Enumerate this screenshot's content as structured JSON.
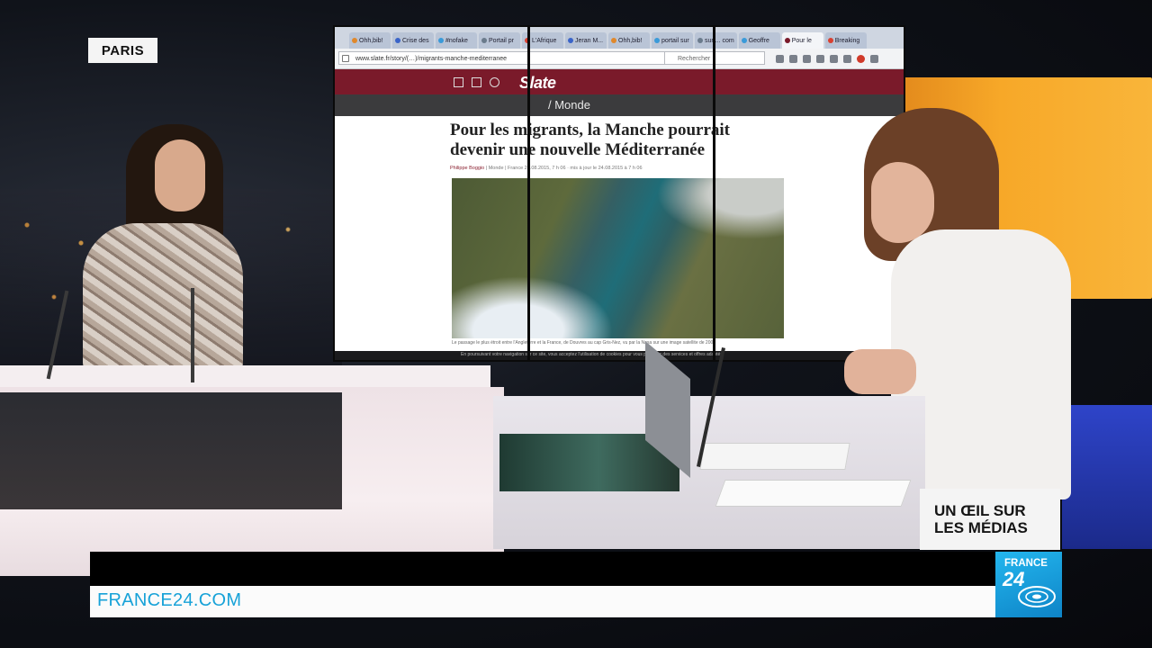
{
  "location": "PARIS",
  "browser": {
    "tabs": [
      {
        "label": "Ohh,bib!",
        "color": "#e0882b",
        "active": false
      },
      {
        "label": "Crise des",
        "color": "#3a64c8",
        "active": false
      },
      {
        "label": "#nofake",
        "color": "#3a9ad9",
        "active": false
      },
      {
        "label": "Portail pr",
        "color": "#6b7b8c",
        "active": false
      },
      {
        "label": "L'Afrique",
        "color": "#d94030",
        "active": false
      },
      {
        "label": "Jeran M...",
        "color": "#3a64c8",
        "active": false
      },
      {
        "label": "Ohh,bib!",
        "color": "#e0882b",
        "active": false
      },
      {
        "label": "portail sur",
        "color": "#3a9ad9",
        "active": false
      },
      {
        "label": "sur ... com",
        "color": "#6b7b8c",
        "active": false
      },
      {
        "label": "Geoffre",
        "color": "#3a9ad9",
        "active": false
      },
      {
        "label": "Pour le",
        "color": "#7a1a2a",
        "active": true
      },
      {
        "label": "Breaking",
        "color": "#d94030",
        "active": false
      }
    ],
    "url": "www.slate.fr/story/(…)/migrants-manche-mediterranee",
    "search_placeholder": "Rechercher",
    "site": {
      "logo": "Slate",
      "section": "/ Monde",
      "headline_line1": "Pour les migrants, la Manche pourrait",
      "headline_line2": "devenir une nouvelle Méditerranée",
      "byline_author": "Philippe Boggio",
      "byline_rest": "| Monde | France   24.08.2015, 7 h 06 · mis à jour le 24.08.2015 à 7 h 06",
      "caption": "Le passage le plus étroit entre l'Angleterre et la France, de Douvres au cap Gris-Nez, vu par la Nasa sur une image satellite de 2003",
      "cookie_notice": "En poursuivant votre navigation sur ce site, vous acceptez l'utilisation de cookies pour vous proposer des services et offres adaptés."
    }
  },
  "show_title_line1": "UN ŒIL SUR",
  "show_title_line2": "LES MÉDIAS",
  "site_url": "FRANCE24.COM",
  "channel_logo": {
    "line1": "FRANCE",
    "line2": "24"
  },
  "colors": {
    "accent": "#17a2d8",
    "slate_brand": "#7a1a2a",
    "studio_orange": "#f7a828"
  }
}
